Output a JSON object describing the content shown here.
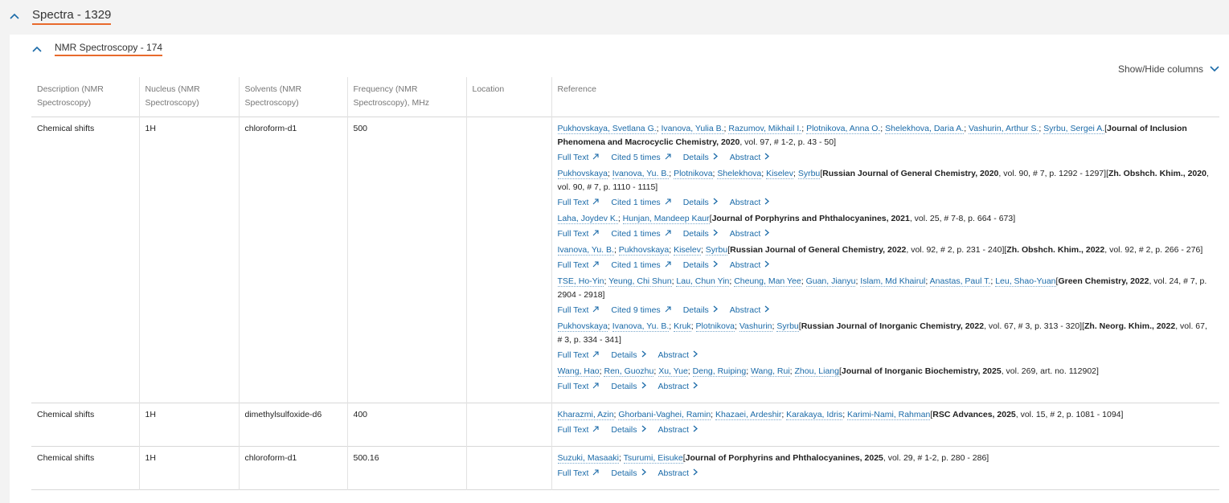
{
  "section": {
    "title": "Spectra - 1329"
  },
  "subsection": {
    "title": "NMR Spectroscopy - 174"
  },
  "showhide_label": "Show/Hide columns",
  "columns": [
    "Description (NMR Spectroscopy)",
    "Nucleus (NMR Spectroscopy)",
    "Solvents (NMR Spectroscopy)",
    "Frequency (NMR Spectroscopy), MHz",
    "Location",
    "Reference"
  ],
  "link_labels": {
    "fulltext": "Full Text",
    "details": "Details",
    "abstract": "Abstract"
  },
  "rows": [
    {
      "description": "Chemical shifts",
      "nucleus": "1H",
      "solvent": "chloroform-d1",
      "frequency": "500",
      "location": "",
      "refs": [
        {
          "parts": [
            {
              "t": "a",
              "v": "Pukhovskaya, Svetlana G."
            },
            {
              "t": "s",
              "v": "; "
            },
            {
              "t": "a",
              "v": "Ivanova, Yulia B."
            },
            {
              "t": "s",
              "v": "; "
            },
            {
              "t": "a",
              "v": "Razumov, Mikhail I."
            },
            {
              "t": "s",
              "v": "; "
            },
            {
              "t": "a",
              "v": "Plotnikova, Anna O."
            },
            {
              "t": "s",
              "v": "; "
            },
            {
              "t": "a",
              "v": "Shelekhova, Daria A."
            },
            {
              "t": "s",
              "v": "; "
            },
            {
              "t": "a",
              "v": "Vashurin, Arthur S."
            },
            {
              "t": "s",
              "v": "; "
            },
            {
              "t": "a",
              "v": "Syrbu, Sergei A."
            },
            {
              "t": "s",
              "v": "["
            },
            {
              "t": "b",
              "v": "Journal of Inclusion Phenomena and Macrocyclic Chemistry, 2020"
            },
            {
              "t": "s",
              "v": ", vol. 97, # 1-2, p. 43 - 50]"
            }
          ],
          "cited": "Cited 5 times"
        },
        {
          "parts": [
            {
              "t": "a",
              "v": "Pukhovskaya"
            },
            {
              "t": "s",
              "v": "; "
            },
            {
              "t": "a",
              "v": "Ivanova, Yu. B."
            },
            {
              "t": "s",
              "v": "; "
            },
            {
              "t": "a",
              "v": "Plotnikova"
            },
            {
              "t": "s",
              "v": "; "
            },
            {
              "t": "a",
              "v": "Shelekhova"
            },
            {
              "t": "s",
              "v": "; "
            },
            {
              "t": "a",
              "v": "Kiselev"
            },
            {
              "t": "s",
              "v": "; "
            },
            {
              "t": "a",
              "v": "Syrbu"
            },
            {
              "t": "s",
              "v": "["
            },
            {
              "t": "b",
              "v": "Russian Journal of General Chemistry, 2020"
            },
            {
              "t": "s",
              "v": ", vol. 90, # 7, p. 1292 - 1297]["
            },
            {
              "t": "b",
              "v": "Zh. Obshch. Khim., 2020"
            },
            {
              "t": "s",
              "v": ", vol. 90, # 7, p. 1110 - 1115]"
            }
          ],
          "cited": "Cited 1 times"
        },
        {
          "parts": [
            {
              "t": "a",
              "v": "Laha, Joydev K."
            },
            {
              "t": "s",
              "v": "; "
            },
            {
              "t": "a",
              "v": "Hunjan, Mandeep Kaur"
            },
            {
              "t": "s",
              "v": "["
            },
            {
              "t": "b",
              "v": "Journal of Porphyrins and Phthalocyanines, 2021"
            },
            {
              "t": "s",
              "v": ", vol. 25, # 7-8, p. 664 - 673]"
            }
          ],
          "cited": "Cited 1 times"
        },
        {
          "parts": [
            {
              "t": "a",
              "v": "Ivanova, Yu. B."
            },
            {
              "t": "s",
              "v": "; "
            },
            {
              "t": "a",
              "v": "Pukhovskaya"
            },
            {
              "t": "s",
              "v": "; "
            },
            {
              "t": "a",
              "v": "Kiselev"
            },
            {
              "t": "s",
              "v": "; "
            },
            {
              "t": "a",
              "v": "Syrbu"
            },
            {
              "t": "s",
              "v": "["
            },
            {
              "t": "b",
              "v": "Russian Journal of General Chemistry, 2022"
            },
            {
              "t": "s",
              "v": ", vol. 92, # 2, p. 231 - 240]["
            },
            {
              "t": "b",
              "v": "Zh. Obshch. Khim., 2022"
            },
            {
              "t": "s",
              "v": ", vol. 92, # 2, p. 266 - 276]"
            }
          ],
          "cited": "Cited 1 times"
        },
        {
          "parts": [
            {
              "t": "a",
              "v": "TSE, Ho-Yin"
            },
            {
              "t": "s",
              "v": "; "
            },
            {
              "t": "a",
              "v": "Yeung, Chi Shun"
            },
            {
              "t": "s",
              "v": "; "
            },
            {
              "t": "a",
              "v": "Lau, Chun Yin"
            },
            {
              "t": "s",
              "v": "; "
            },
            {
              "t": "a",
              "v": "Cheung, Man Yee"
            },
            {
              "t": "s",
              "v": "; "
            },
            {
              "t": "a",
              "v": "Guan, Jianyu"
            },
            {
              "t": "s",
              "v": "; "
            },
            {
              "t": "a",
              "v": "Islam, Md Khairul"
            },
            {
              "t": "s",
              "v": "; "
            },
            {
              "t": "a",
              "v": "Anastas, Paul T."
            },
            {
              "t": "s",
              "v": "; "
            },
            {
              "t": "a",
              "v": "Leu, Shao-Yuan"
            },
            {
              "t": "s",
              "v": "["
            },
            {
              "t": "b",
              "v": "Green Chemistry, 2022"
            },
            {
              "t": "s",
              "v": ", vol. 24, # 7, p. 2904 - 2918]"
            }
          ],
          "cited": "Cited 9 times"
        },
        {
          "parts": [
            {
              "t": "a",
              "v": "Pukhovskaya"
            },
            {
              "t": "s",
              "v": "; "
            },
            {
              "t": "a",
              "v": "Ivanova, Yu. B."
            },
            {
              "t": "s",
              "v": "; "
            },
            {
              "t": "a",
              "v": "Kruk"
            },
            {
              "t": "s",
              "v": "; "
            },
            {
              "t": "a",
              "v": "Plotnikova"
            },
            {
              "t": "s",
              "v": "; "
            },
            {
              "t": "a",
              "v": "Vashurin"
            },
            {
              "t": "s",
              "v": "; "
            },
            {
              "t": "a",
              "v": "Syrbu"
            },
            {
              "t": "s",
              "v": "["
            },
            {
              "t": "b",
              "v": "Russian Journal of Inorganic Chemistry, 2022"
            },
            {
              "t": "s",
              "v": ", vol. 67, # 3, p. 313 - 320]["
            },
            {
              "t": "b",
              "v": "Zh. Neorg. Khim., 2022"
            },
            {
              "t": "s",
              "v": ", vol. 67, # 3, p. 334 - 341]"
            }
          ],
          "cited": ""
        },
        {
          "parts": [
            {
              "t": "a",
              "v": "Wang, Hao"
            },
            {
              "t": "s",
              "v": "; "
            },
            {
              "t": "a",
              "v": "Ren, Guozhu"
            },
            {
              "t": "s",
              "v": "; "
            },
            {
              "t": "a",
              "v": "Xu, Yue"
            },
            {
              "t": "s",
              "v": "; "
            },
            {
              "t": "a",
              "v": "Deng, Ruiping"
            },
            {
              "t": "s",
              "v": "; "
            },
            {
              "t": "a",
              "v": "Wang, Rui"
            },
            {
              "t": "s",
              "v": "; "
            },
            {
              "t": "a",
              "v": "Zhou, Liang"
            },
            {
              "t": "s",
              "v": "["
            },
            {
              "t": "b",
              "v": "Journal of Inorganic Biochemistry, 2025"
            },
            {
              "t": "s",
              "v": ", vol. 269, art. no. 112902]"
            }
          ],
          "cited": ""
        }
      ]
    },
    {
      "description": "Chemical shifts",
      "nucleus": "1H",
      "solvent": "dimethylsulfoxide-d6",
      "frequency": "400",
      "location": "",
      "refs": [
        {
          "parts": [
            {
              "t": "a",
              "v": "Kharazmi, Azin"
            },
            {
              "t": "s",
              "v": "; "
            },
            {
              "t": "a",
              "v": "Ghorbani-Vaghei, Ramin"
            },
            {
              "t": "s",
              "v": "; "
            },
            {
              "t": "a",
              "v": "Khazaei, Ardeshir"
            },
            {
              "t": "s",
              "v": "; "
            },
            {
              "t": "a",
              "v": "Karakaya, Idris"
            },
            {
              "t": "s",
              "v": "; "
            },
            {
              "t": "a",
              "v": "Karimi-Nami, Rahman"
            },
            {
              "t": "s",
              "v": "["
            },
            {
              "t": "b",
              "v": "RSC Advances, 2025"
            },
            {
              "t": "s",
              "v": ", vol. 15, # 2, p. 1081 - 1094]"
            }
          ],
          "cited": ""
        }
      ]
    },
    {
      "description": "Chemical shifts",
      "nucleus": "1H",
      "solvent": "chloroform-d1",
      "frequency": "500.16",
      "location": "",
      "refs": [
        {
          "parts": [
            {
              "t": "a",
              "v": "Suzuki, Masaaki"
            },
            {
              "t": "s",
              "v": "; "
            },
            {
              "t": "a",
              "v": "Tsurumi, Eisuke"
            },
            {
              "t": "s",
              "v": "["
            },
            {
              "t": "b",
              "v": "Journal of Porphyrins and Phthalocyanines, 2025"
            },
            {
              "t": "s",
              "v": ", vol. 29, # 1-2, p. 280 - 286]"
            }
          ],
          "cited": ""
        }
      ]
    }
  ]
}
